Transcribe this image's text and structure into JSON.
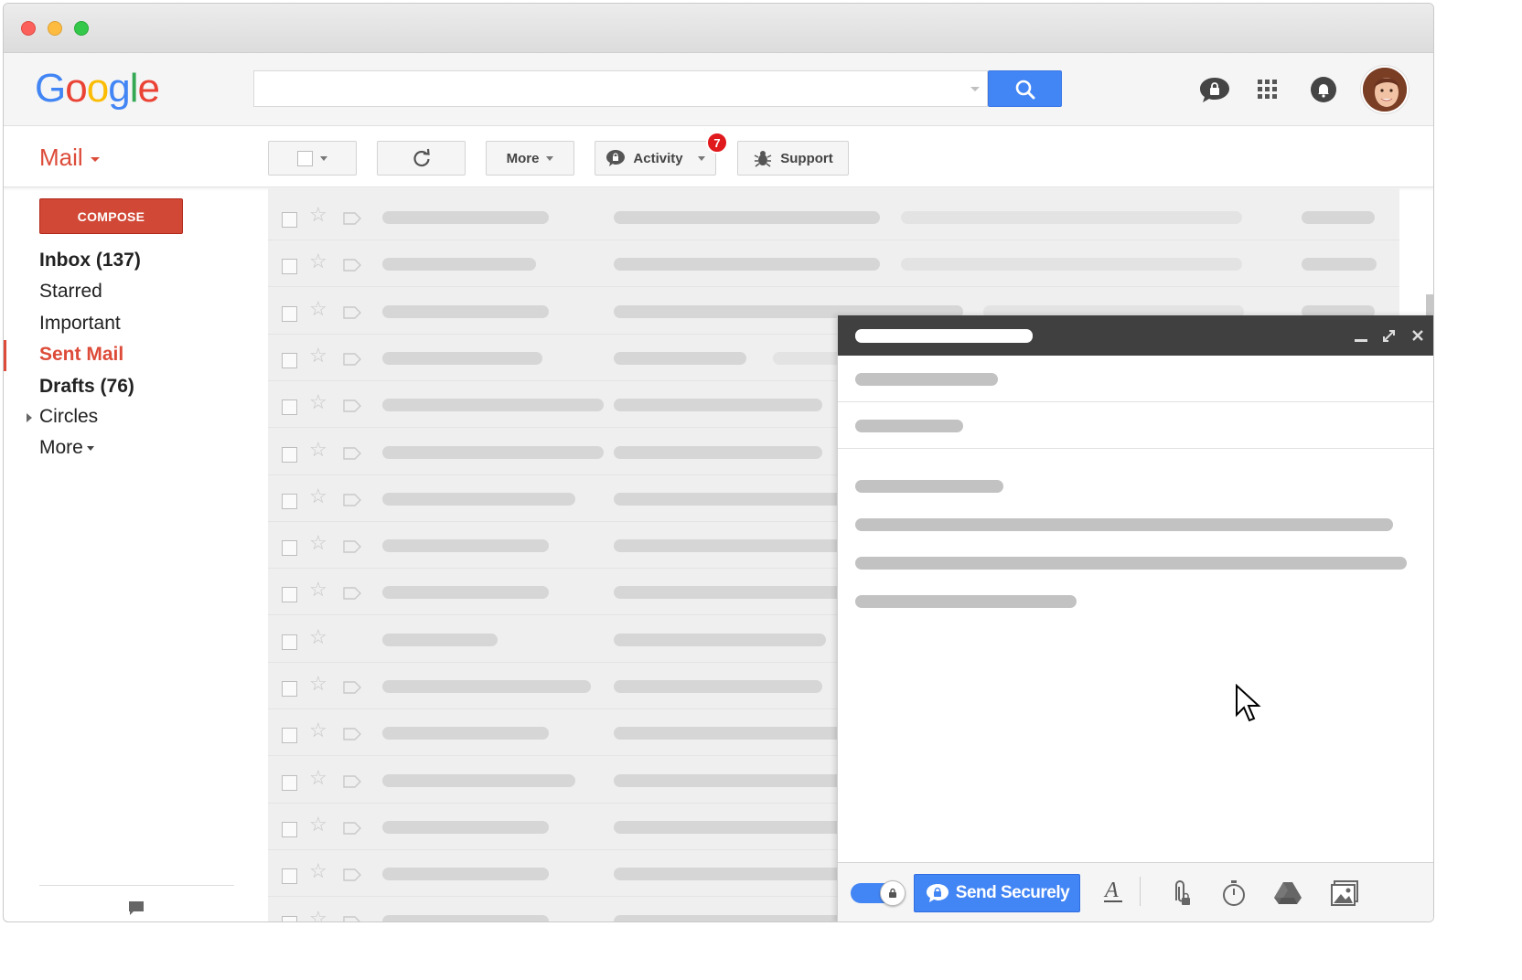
{
  "header": {
    "logo_text": "Google",
    "logo_colors": [
      "#4285f4",
      "#ea4335",
      "#fbbc05",
      "#4285f4",
      "#34a853",
      "#ea4335"
    ],
    "search": {
      "value": "",
      "placeholder": ""
    }
  },
  "toolbar": {
    "app_label": "Mail",
    "more_label": "More",
    "activity_label": "Activity",
    "activity_badge": "7",
    "support_label": "Support"
  },
  "sidebar": {
    "compose_label": "COMPOSE",
    "items": [
      {
        "label": "Inbox (137)"
      },
      {
        "label": "Starred"
      },
      {
        "label": "Important"
      },
      {
        "label": "Sent Mail"
      },
      {
        "label": "Drafts (76)"
      },
      {
        "label": "Circles"
      },
      {
        "label": "More"
      }
    ]
  },
  "compose_window": {
    "send_label": "Send Securely",
    "secure_toggle_on": true
  },
  "colors": {
    "accent_red": "#dd4b39",
    "accent_blue": "#4285f4",
    "badge_red": "#e0191d"
  },
  "icons": {
    "header": [
      "secure-chat-icon",
      "apps-grid-icon",
      "notifications-icon",
      "avatar"
    ],
    "compose_footer": [
      "formatting-icon",
      "secure-attachment-icon",
      "timer-icon",
      "drive-icon",
      "image-icon"
    ]
  }
}
